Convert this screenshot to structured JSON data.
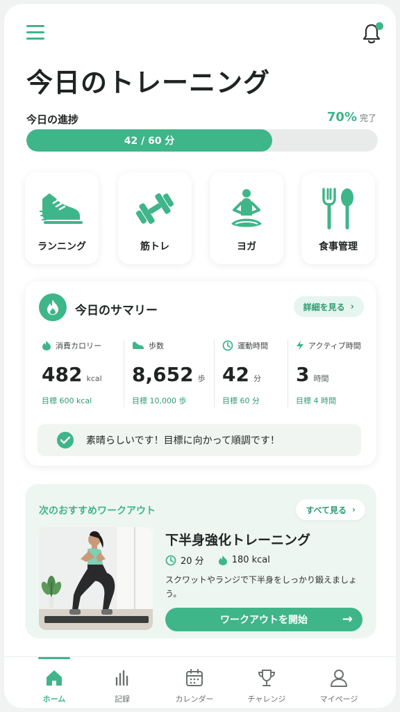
{
  "header": {
    "title": "今日のトレーニング"
  },
  "progress": {
    "label": "今日の進捗",
    "percent_text": "70%",
    "complete_text": "完了",
    "bar_text": "42 / 60 分",
    "fraction": 0.7
  },
  "categories": [
    {
      "label": "ランニング",
      "icon": "running-shoe-icon"
    },
    {
      "label": "筋トレ",
      "icon": "dumbbell-icon"
    },
    {
      "label": "ヨガ",
      "icon": "yoga-icon"
    },
    {
      "label": "食事管理",
      "icon": "fork-spoon-icon"
    }
  ],
  "summary": {
    "title": "今日のサマリー",
    "details_button": "詳細を見る",
    "stats": [
      {
        "label": "消費カロリー",
        "value": "482",
        "unit": "kcal",
        "goal": "目標 600 kcal",
        "icon": "flame-icon"
      },
      {
        "label": "歩数",
        "value": "8,652",
        "unit": "歩",
        "goal": "目標 10,000 歩",
        "icon": "shoe-icon"
      },
      {
        "label": "運動時間",
        "value": "42",
        "unit": "分",
        "goal": "目標 60 分",
        "icon": "clock-icon"
      },
      {
        "label": "アクティブ時間",
        "value": "3",
        "unit": "時間",
        "goal": "目標 4 時間",
        "icon": "lightning-icon"
      }
    ],
    "message": "素晴らしいです！目標に向かって順調です！"
  },
  "recommended": {
    "title": "次のおすすめワークアウト",
    "see_all": "すべて見る",
    "workout_name": "下半身強化トレーニング",
    "duration": "20 分",
    "calories": "180 kcal",
    "description": "スクワットやランジで下半身をしっかり鍛えましょう。",
    "start_button": "ワークアウトを開始"
  },
  "nav": [
    {
      "label": "ホーム",
      "icon": "home-icon",
      "active": true
    },
    {
      "label": "記録",
      "icon": "bar-chart-icon"
    },
    {
      "label": "カレンダー",
      "icon": "calendar-icon"
    },
    {
      "label": "チャレンジ",
      "icon": "trophy-icon"
    },
    {
      "label": "マイページ",
      "icon": "user-icon"
    }
  ],
  "colors": {
    "accent": "#3fb58a",
    "accent_light": "#e6f5ef",
    "card_tint": "#eef6f2"
  }
}
